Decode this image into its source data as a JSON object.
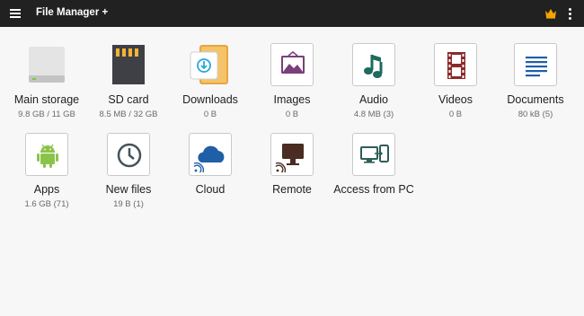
{
  "app": {
    "title": "File Manager +",
    "accent": "#212121",
    "icons": [
      "menu-icon",
      "crown-icon",
      "more-vert-icon"
    ]
  },
  "tiles": [
    {
      "label": "Main storage",
      "sub": "9.8 GB / 11 GB",
      "icon": "hard-drive-icon"
    },
    {
      "label": "SD card",
      "sub": "8.5 MB / 32 GB",
      "icon": "sd-card-icon"
    },
    {
      "label": "Downloads",
      "sub": "0 B",
      "icon": "download-folder-icon"
    },
    {
      "label": "Images",
      "sub": "0 B",
      "icon": "image-icon"
    },
    {
      "label": "Audio",
      "sub": "4.8 MB (3)",
      "icon": "music-note-icon"
    },
    {
      "label": "Videos",
      "sub": "0 B",
      "icon": "film-icon"
    },
    {
      "label": "Documents",
      "sub": "80 kB (5)",
      "icon": "document-icon"
    },
    {
      "label": "Apps",
      "sub": "1.6 GB (71)",
      "icon": "android-icon"
    },
    {
      "label": "New files",
      "sub": "19 B (1)",
      "icon": "clock-icon"
    },
    {
      "label": "Cloud",
      "sub": "",
      "icon": "cloud-icon"
    },
    {
      "label": "Remote",
      "sub": "",
      "icon": "remote-monitor-icon"
    },
    {
      "label": "Access from PC",
      "sub": "",
      "icon": "pc-access-icon"
    }
  ]
}
